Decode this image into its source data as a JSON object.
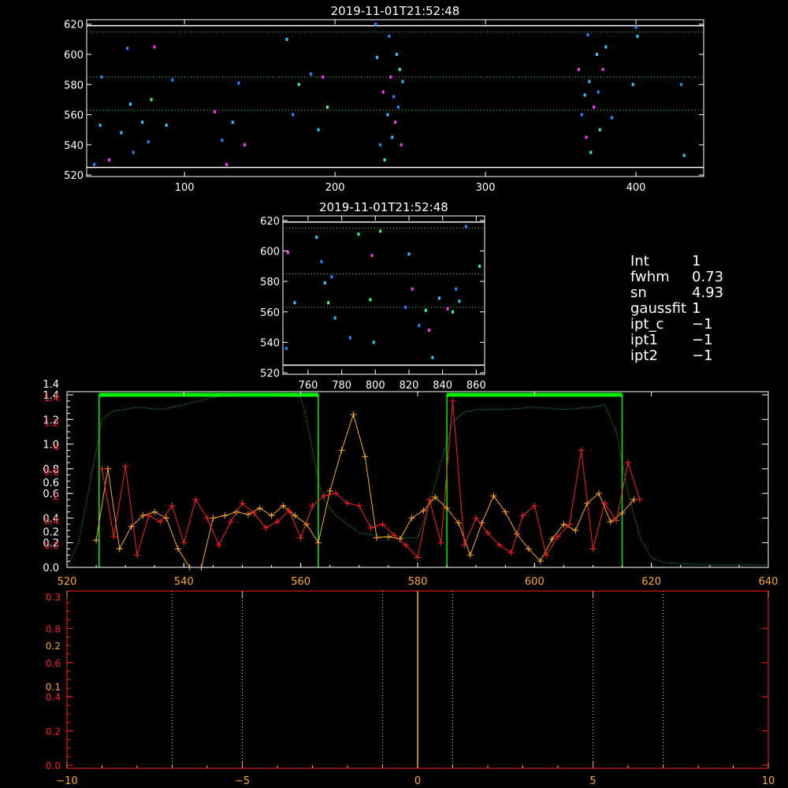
{
  "colors": {
    "background": "#000000",
    "axes": "#ffffff",
    "guide_green": "#22dd44",
    "solid_white": "#ffffff",
    "box_green": "#00ee00",
    "series_red": "#ff2020",
    "series_orange": "#ffaa22",
    "dot_colors": [
      "#2288ff",
      "#22ccff",
      "#33ff88",
      "#ff33ff",
      "#ffffff"
    ]
  },
  "info_panel": [
    {
      "key": "Int",
      "value": "1"
    },
    {
      "key": "fwhm",
      "value": "0.73"
    },
    {
      "key": "sn",
      "value": "4.93"
    },
    {
      "key": "gaussfit",
      "value": "1"
    },
    {
      "key": "ipt_c",
      "value": "−1"
    },
    {
      "key": "ipt1",
      "value": "−1"
    },
    {
      "key": "ipt2",
      "value": "−1"
    }
  ],
  "chart_data": [
    {
      "type": "scatter",
      "title": "2019-11-01T21:52:48",
      "xlim": [
        35,
        445
      ],
      "ylim": [
        519,
        623
      ],
      "xticks": [
        100,
        200,
        300,
        400
      ],
      "yticks": [
        520,
        540,
        560,
        580,
        600,
        620
      ],
      "hlines_dotted": [
        615,
        585,
        563
      ],
      "hlines_solid": [
        619,
        525
      ],
      "points": [
        [
          40,
          527,
          0
        ],
        [
          44,
          553,
          1
        ],
        [
          45,
          585,
          0
        ],
        [
          50,
          530,
          3
        ],
        [
          58,
          548,
          1
        ],
        [
          62,
          604,
          0
        ],
        [
          64,
          567,
          1
        ],
        [
          66,
          535,
          0
        ],
        [
          72,
          555,
          1
        ],
        [
          76,
          542,
          0
        ],
        [
          78,
          570,
          2
        ],
        [
          80,
          605,
          3
        ],
        [
          88,
          553,
          1
        ],
        [
          92,
          583,
          0
        ],
        [
          120,
          562,
          3
        ],
        [
          125,
          543,
          0
        ],
        [
          128,
          527,
          3
        ],
        [
          132,
          555,
          1
        ],
        [
          136,
          581,
          0
        ],
        [
          140,
          540,
          3
        ],
        [
          168,
          610,
          1
        ],
        [
          172,
          560,
          0
        ],
        [
          176,
          580,
          2
        ],
        [
          184,
          587,
          0
        ],
        [
          189,
          550,
          1
        ],
        [
          192,
          585,
          3
        ],
        [
          195,
          565,
          2
        ],
        [
          227,
          620,
          0
        ],
        [
          228,
          598,
          1
        ],
        [
          230,
          540,
          0
        ],
        [
          232,
          575,
          3
        ],
        [
          233,
          530,
          2
        ],
        [
          235,
          560,
          1
        ],
        [
          236,
          612,
          0
        ],
        [
          237,
          585,
          3
        ],
        [
          238,
          545,
          1
        ],
        [
          239,
          572,
          0
        ],
        [
          240,
          555,
          3
        ],
        [
          241,
          600,
          1
        ],
        [
          242,
          565,
          0
        ],
        [
          243,
          590,
          2
        ],
        [
          244,
          540,
          3
        ],
        [
          245,
          582,
          1
        ],
        [
          362,
          590,
          3
        ],
        [
          364,
          560,
          0
        ],
        [
          366,
          573,
          1
        ],
        [
          367,
          545,
          3
        ],
        [
          368,
          613,
          0
        ],
        [
          369,
          582,
          1
        ],
        [
          370,
          535,
          2
        ],
        [
          372,
          565,
          3
        ],
        [
          374,
          600,
          1
        ],
        [
          375,
          575,
          0
        ],
        [
          376,
          550,
          2
        ],
        [
          378,
          590,
          3
        ],
        [
          380,
          605,
          1
        ],
        [
          384,
          558,
          0
        ],
        [
          398,
          580,
          1
        ],
        [
          400,
          618,
          0
        ],
        [
          401,
          612,
          1
        ],
        [
          430,
          580,
          0
        ],
        [
          432,
          533,
          1
        ]
      ]
    },
    {
      "type": "scatter",
      "title": "2019-11-01T21:52:48",
      "xlim": [
        745,
        865
      ],
      "ylim": [
        519,
        623
      ],
      "xticks": [
        760,
        780,
        800,
        820,
        840,
        860
      ],
      "yticks": [
        520,
        540,
        560,
        580,
        600,
        620
      ],
      "hlines_dotted": [
        615,
        585,
        563
      ],
      "hlines_solid": [
        619,
        525
      ],
      "points": [
        [
          747,
          536,
          0
        ],
        [
          748,
          599,
          3
        ],
        [
          752,
          566,
          1
        ],
        [
          765,
          609,
          1
        ],
        [
          768,
          593,
          0
        ],
        [
          770,
          579,
          1
        ],
        [
          772,
          566,
          2
        ],
        [
          774,
          583,
          0
        ],
        [
          776,
          556,
          1
        ],
        [
          785,
          543,
          0
        ],
        [
          790,
          611,
          2
        ],
        [
          797,
          568,
          2
        ],
        [
          798,
          597,
          3
        ],
        [
          799,
          540,
          1
        ],
        [
          803,
          613,
          2
        ],
        [
          818,
          563,
          0
        ],
        [
          820,
          598,
          1
        ],
        [
          822,
          575,
          3
        ],
        [
          826,
          551,
          0
        ],
        [
          830,
          561,
          2
        ],
        [
          832,
          548,
          3
        ],
        [
          834,
          530,
          1
        ],
        [
          838,
          569,
          1
        ],
        [
          843,
          562,
          3
        ],
        [
          846,
          560,
          2
        ],
        [
          850,
          567,
          1
        ],
        [
          854,
          616,
          0
        ],
        [
          862,
          590,
          2
        ],
        [
          848,
          575,
          0
        ]
      ]
    },
    {
      "type": "line",
      "xlim": [
        520,
        640
      ],
      "ylim_red": [
        0,
        1.4
      ],
      "xticks": [
        520,
        540,
        560,
        580,
        600,
        620,
        640
      ],
      "yticks_white": [
        0.0,
        0.2,
        0.4,
        0.6,
        0.8,
        1.0,
        1.2,
        1.4
      ],
      "yticks_white_extra": [
        0.2,
        0.6,
        1.4
      ],
      "yticks_red": [
        "0.2",
        "0.4",
        "2",
        "0.8",
        "4",
        "1.2",
        "1.4"
      ],
      "box_regions": [
        [
          525.5,
          563
        ],
        [
          585,
          615
        ]
      ],
      "box_top": 1.4,
      "series": [
        {
          "x": [
            525,
            527,
            529,
            531,
            533,
            535,
            537,
            539,
            541,
            543,
            545,
            547,
            549,
            551,
            553,
            555,
            557,
            559,
            561,
            563,
            565,
            567,
            569,
            571,
            573,
            575,
            577,
            579,
            581,
            583,
            585,
            587,
            589,
            591,
            593,
            595,
            597,
            599,
            601,
            603,
            605,
            607,
            609,
            611,
            613,
            615,
            617
          ],
          "values": [
            0.22,
            0.8,
            0.15,
            0.33,
            0.42,
            0.45,
            0.4,
            0.15,
            0.0,
            0.0,
            0.4,
            0.42,
            0.45,
            0.43,
            0.48,
            0.42,
            0.5,
            0.42,
            0.35,
            0.2,
            0.62,
            0.95,
            1.24,
            0.9,
            0.24,
            0.25,
            0.23,
            0.4,
            0.46,
            0.57,
            0.48,
            0.36,
            0.1,
            0.36,
            0.58,
            0.45,
            0.27,
            0.15,
            0.05,
            0.23,
            0.35,
            0.3,
            0.52,
            0.6,
            0.37,
            0.44,
            0.55
          ]
        },
        {
          "x": [
            526,
            528,
            530,
            532,
            534,
            536,
            538,
            540,
            542,
            544,
            546,
            548,
            550,
            552,
            554,
            556,
            558,
            560,
            562,
            564,
            566,
            568,
            570,
            572,
            574,
            576,
            578,
            580,
            582,
            584,
            586,
            588,
            590,
            592,
            594,
            596,
            598,
            600,
            602,
            604,
            606,
            608,
            610,
            612,
            614,
            616,
            618
          ],
          "values": [
            0.8,
            0.25,
            0.82,
            0.1,
            0.42,
            0.37,
            0.5,
            0.2,
            0.55,
            0.4,
            0.18,
            0.37,
            0.52,
            0.44,
            0.32,
            0.37,
            0.46,
            0.24,
            0.5,
            0.58,
            0.6,
            0.52,
            0.5,
            0.32,
            0.35,
            0.26,
            0.18,
            0.08,
            0.55,
            0.2,
            1.35,
            0.18,
            0.4,
            0.28,
            0.18,
            0.12,
            0.42,
            0.5,
            0.1,
            0.25,
            0.35,
            0.95,
            0.15,
            0.52,
            0.38,
            0.85,
            0.55
          ]
        },
        {
          "x": [
            520,
            522,
            524,
            526,
            528,
            530,
            532,
            536,
            540,
            545,
            550,
            555,
            560,
            561,
            562,
            563,
            564,
            565,
            566,
            568,
            570,
            575,
            580,
            582,
            584,
            586,
            588,
            590,
            595,
            600,
            605,
            610,
            612,
            614,
            616,
            618,
            620,
            622,
            625,
            630,
            635,
            640
          ],
          "values": [
            0.0,
            0.2,
            0.7,
            1.2,
            1.27,
            1.28,
            1.3,
            1.28,
            1.32,
            1.38,
            1.4,
            1.4,
            1.38,
            1.2,
            0.95,
            0.7,
            0.55,
            0.48,
            0.42,
            0.35,
            0.28,
            0.24,
            0.24,
            0.5,
            0.85,
            1.18,
            1.26,
            1.28,
            1.28,
            1.3,
            1.28,
            1.3,
            1.32,
            1.1,
            0.6,
            0.25,
            0.08,
            0.04,
            0.03,
            0.02,
            0.02,
            0.02
          ]
        }
      ]
    },
    {
      "type": "line",
      "xlim": [
        -10,
        10
      ],
      "ylim": [
        0,
        1
      ],
      "xticks": [
        -10,
        -5,
        0,
        5,
        10
      ],
      "yticks_red": [
        "0.0",
        "0.2",
        "0.4",
        "0.6",
        "0.8",
        "0.3"
      ],
      "yticks_orange": [
        "0.1",
        "0.2"
      ],
      "vlines_dotted": [
        -7,
        -5,
        -1,
        1,
        5,
        7
      ],
      "vline_solid": 0
    }
  ]
}
